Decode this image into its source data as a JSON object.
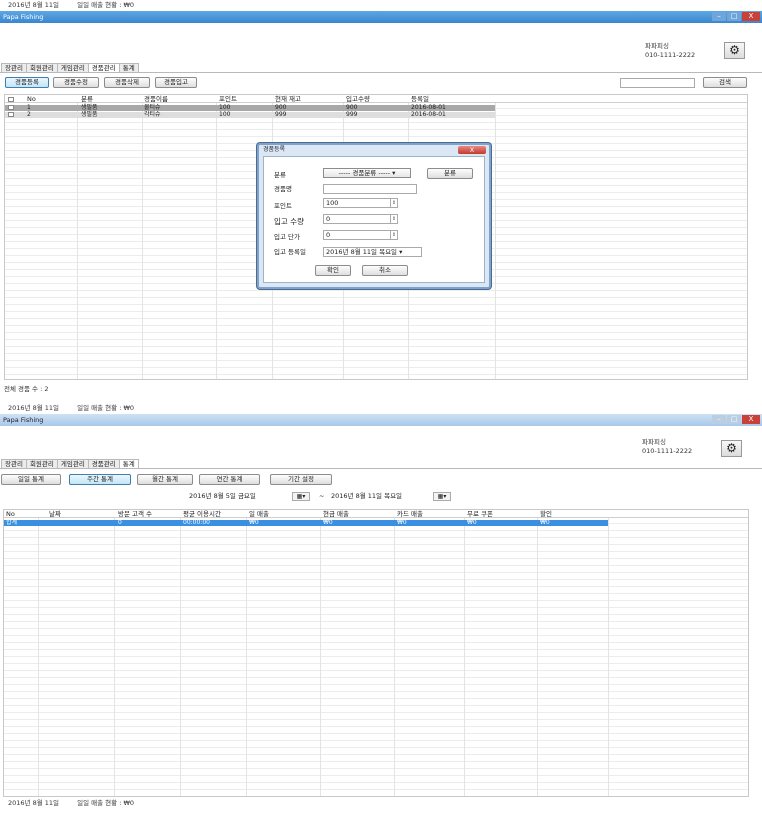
{
  "window1": {
    "top_status": {
      "date": "2016년 8월 11일",
      "sales": "일일 매출 현황 : ₩0"
    },
    "title": "Papa Fishing",
    "window_controls": [
      "–",
      "□",
      "X"
    ],
    "brand": {
      "name": "파파피싱",
      "phone": "010-1111-2222"
    },
    "tabs": [
      "장관리",
      "회원관리",
      "게임관리",
      "경품관리",
      "통계"
    ],
    "active_tab": "경품관리",
    "toolbar": {
      "register": "경품등록",
      "edit": "경품수정",
      "delete": "경품삭제",
      "stock_in": "경품입고",
      "search": "검색"
    },
    "table": {
      "columns": [
        "No",
        "분류",
        "경품이름",
        "포인트",
        "현재 재고",
        "입고수량",
        "등록일"
      ],
      "rows": [
        {
          "no": "1",
          "category": "생필품",
          "name": "물티슈",
          "point": "100",
          "stock": "900",
          "incoming": "900",
          "date": "2016-08-01"
        },
        {
          "no": "2",
          "category": "생필품",
          "name": "각티슈",
          "point": "100",
          "stock": "999",
          "incoming": "999",
          "date": "2016-08-01"
        }
      ]
    },
    "dialog": {
      "title": "경품등록",
      "close": "X",
      "labels": {
        "category": "분류",
        "name": "경품명",
        "point": "포인트",
        "qty": "입고 수량",
        "price": "입고 단가",
        "date": "입고 등록일"
      },
      "category_select": "----- 경품분류 -----",
      "category_button": "분류",
      "point_value": "100",
      "qty_value": "0",
      "price_value": "0",
      "date_value": "2016년 8월 11일 목요일",
      "ok": "확인",
      "cancel": "취소"
    },
    "total": "전체 경품 수 : 2"
  },
  "window2": {
    "top_status": {
      "date": "2016년 8월 11일",
      "sales": "일일 매출 현황 : ₩0"
    },
    "title": "Papa Fishing",
    "brand": {
      "name": "파파피싱",
      "phone": "010-1111-2222"
    },
    "tabs": [
      "장관리",
      "회원관리",
      "게임관리",
      "경품관리",
      "통계"
    ],
    "active_tab": "통계",
    "toolbar": {
      "daily": "일일 통계",
      "weekly": "주간 통계",
      "monthly": "월간 통계",
      "yearly": "연간 통계",
      "period": "기간 설정"
    },
    "range": {
      "start": "2016년 8월 5일 금요일",
      "sep": "~",
      "end": "2016년 8월 11일 목요일"
    },
    "table": {
      "columns": [
        "No",
        "날짜",
        "방문 고객 수",
        "평균 이용시간",
        "일 매출",
        "현금 매출",
        "카드 매출",
        "무료 쿠폰",
        "할인"
      ],
      "row": {
        "no": "합계",
        "date": "",
        "visitors": "0",
        "avg_time": "00:00:00",
        "daily": "₩0",
        "cash": "₩0",
        "card": "₩0",
        "coupon": "₩0",
        "discount": "₩0"
      }
    },
    "bottom_status": {
      "date": "2016년 8월 11일",
      "sales": "일일 매출 현황 : ₩0"
    }
  }
}
